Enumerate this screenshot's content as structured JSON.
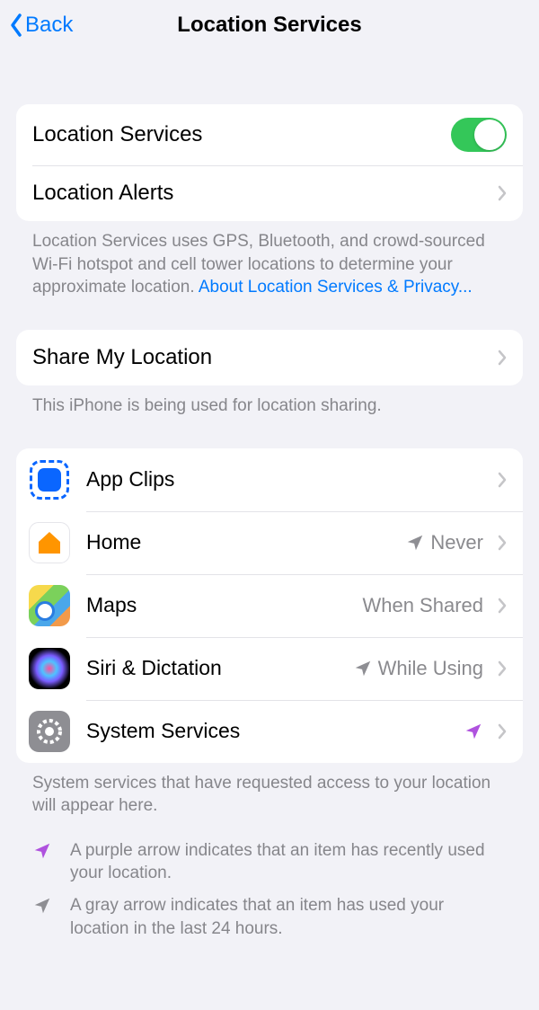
{
  "nav": {
    "back": "Back",
    "title": "Location Services"
  },
  "group1": {
    "location_services_label": "Location Services",
    "location_services_on": true,
    "location_alerts_label": "Location Alerts"
  },
  "footer1": {
    "text": "Location Services uses GPS, Bluetooth, and crowd-sourced Wi-Fi hotspot and cell tower locations to determine your approximate location. ",
    "link": "About Location Services & Privacy..."
  },
  "group2": {
    "share_my_location_label": "Share My Location"
  },
  "footer2": "This iPhone is being used for location sharing.",
  "apps": [
    {
      "name": "App Clips",
      "status": "",
      "arrow": "none",
      "icon": "appclips"
    },
    {
      "name": "Home",
      "status": "Never",
      "arrow": "gray",
      "icon": "home"
    },
    {
      "name": "Maps",
      "status": "When Shared",
      "arrow": "none",
      "icon": "maps"
    },
    {
      "name": "Siri & Dictation",
      "status": "While Using",
      "arrow": "gray",
      "icon": "siri"
    },
    {
      "name": "System Services",
      "status": "",
      "arrow": "purple",
      "icon": "system"
    }
  ],
  "footer3": "System services that have requested access to your location will appear here.",
  "legend": {
    "purple": "A purple arrow indicates that an item has recently used your location.",
    "gray": "A gray arrow indicates that an item has used your location in the last 24 hours."
  }
}
